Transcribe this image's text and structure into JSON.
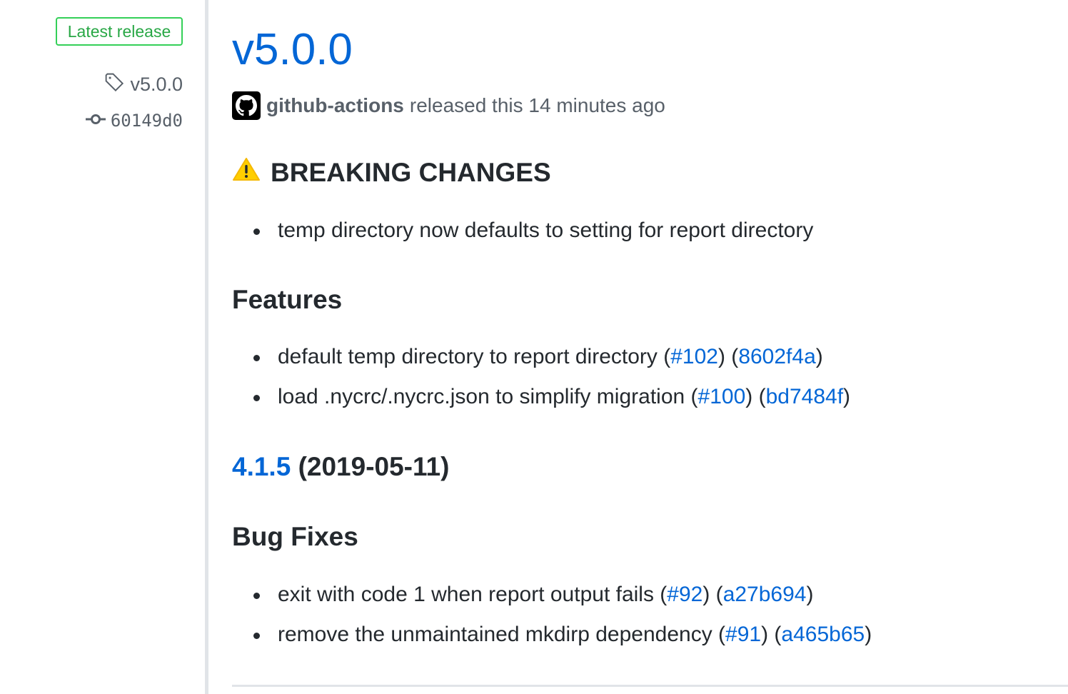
{
  "sidebar": {
    "badge_label": "Latest release",
    "tag_label": "v5.0.0",
    "commit_label": "60149d0"
  },
  "release": {
    "title": "v5.0.0",
    "author": "github-actions",
    "released_text": "released this 14 minutes ago"
  },
  "body": {
    "breaking_heading": "BREAKING CHANGES",
    "breaking_items": [
      {
        "text": "temp directory now defaults to setting for report directory"
      }
    ],
    "features_heading": "Features",
    "features_items": [
      {
        "text": "default temp directory to report directory (",
        "pr": "#102",
        "mid": ") (",
        "commit": "8602f4a",
        "end": ")"
      },
      {
        "text": "load .nycrc/.nycrc.json to simplify migration (",
        "pr": "#100",
        "mid": ") (",
        "commit": "bd7484f",
        "end": ")"
      }
    ],
    "version_link": "4.1.5",
    "version_date": "(2019-05-11)",
    "bugfixes_heading": "Bug Fixes",
    "bugfix_items": [
      {
        "text": "exit with code 1 when report output fails (",
        "pr": "#92",
        "mid": ") (",
        "commit": "a27b694",
        "end": ")"
      },
      {
        "text": "remove the unmaintained mkdirp dependency (",
        "pr": "#91",
        "mid": ") (",
        "commit": "a465b65",
        "end": ")"
      }
    ]
  },
  "colors": {
    "link": "#0366d6",
    "badge_green": "#28a745",
    "text": "#24292e",
    "muted": "#586069",
    "warning_yellow": "#ffce00"
  }
}
